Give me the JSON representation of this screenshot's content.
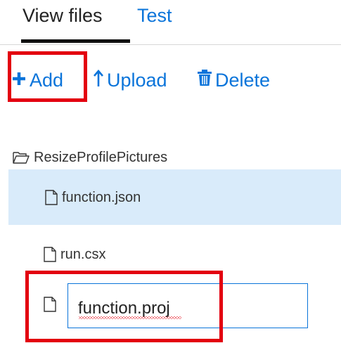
{
  "tabs": [
    {
      "label": "View files",
      "active": true
    },
    {
      "label": "Test",
      "active": false
    }
  ],
  "toolbar": {
    "add": {
      "label": "Add",
      "icon": "plus-icon"
    },
    "upload": {
      "label": "Upload",
      "icon": "upload-arrow-icon"
    },
    "delete": {
      "label": "Delete",
      "icon": "trash-icon"
    }
  },
  "tree": {
    "folder": {
      "name": "ResizeProfilePictures",
      "icon": "folder-open-icon"
    },
    "files": [
      {
        "name": "function.json",
        "icon": "file-icon",
        "selected": true
      },
      {
        "name": "run.csx",
        "icon": "file-icon",
        "selected": false
      }
    ],
    "new_file": {
      "value": "function.proj",
      "icon": "file-icon"
    }
  },
  "colors": {
    "accent": "#0a74da",
    "selection": "#d9ebfa",
    "highlight": "#e3000f"
  }
}
